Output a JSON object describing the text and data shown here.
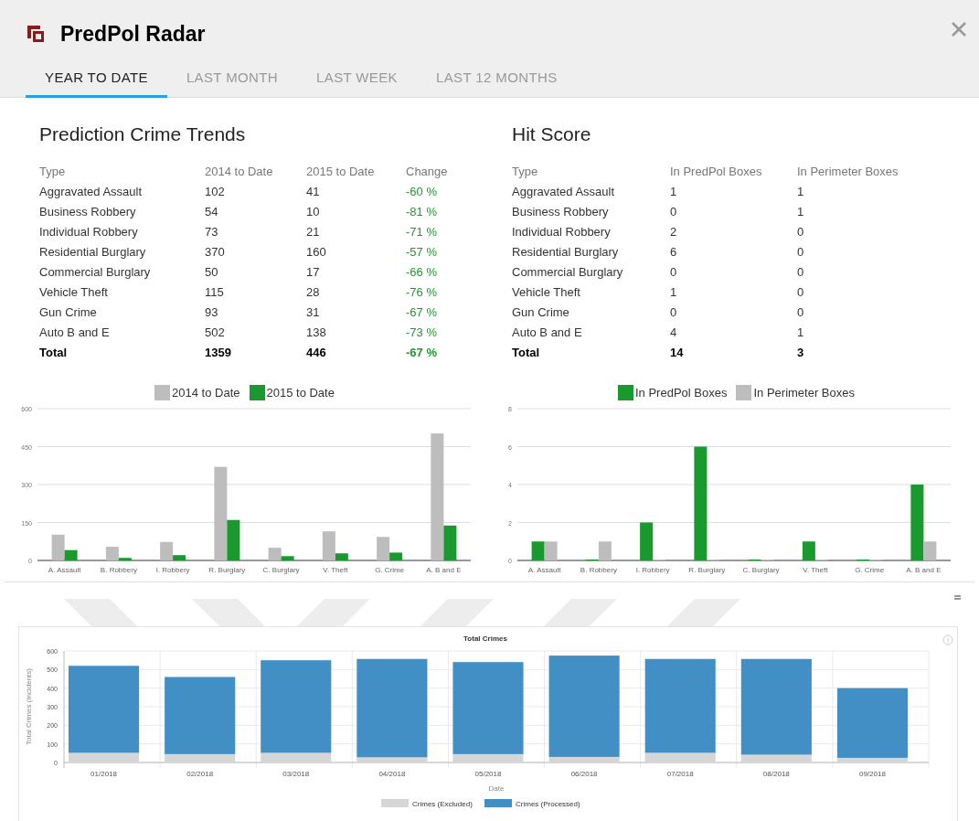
{
  "window": {
    "title": "PredPol Radar"
  },
  "tabs": [
    {
      "label": "YEAR TO DATE",
      "selected": true
    },
    {
      "label": "LAST MONTH",
      "selected": false
    },
    {
      "label": "LAST WEEK",
      "selected": false
    },
    {
      "label": "LAST 12 MONTHS",
      "selected": false
    }
  ],
  "prediction_trends": {
    "title": "Prediction Crime Trends",
    "columns": [
      "Type",
      "2014 to Date",
      "2015 to Date",
      "Change"
    ],
    "rows": [
      {
        "kind": "item",
        "cells": [
          "Aggravated Assault",
          "102",
          "41",
          "-60 %"
        ]
      },
      {
        "kind": "item",
        "cells": [
          "Business Robbery",
          "54",
          "10",
          "-81 %"
        ]
      },
      {
        "kind": "item",
        "cells": [
          "Individual Robbery",
          "73",
          "21",
          "-71 %"
        ]
      },
      {
        "kind": "item",
        "cells": [
          "Residential Burglary",
          "370",
          "160",
          "-57 %"
        ]
      },
      {
        "kind": "item",
        "cells": [
          "Commercial Burglary",
          "50",
          "17",
          "-66 %"
        ]
      },
      {
        "kind": "item",
        "cells": [
          "Vehicle Theft",
          "115",
          "28",
          "-76 %"
        ]
      },
      {
        "kind": "item",
        "cells": [
          "Gun Crime",
          "93",
          "31",
          "-67 %"
        ]
      },
      {
        "kind": "item",
        "cells": [
          "Auto B and E",
          "502",
          "138",
          "-73 %"
        ]
      },
      {
        "kind": "total",
        "cells": [
          "Total",
          "1359",
          "446",
          "-67 %"
        ]
      }
    ],
    "chart_data": {
      "type": "bar",
      "grid": true,
      "legend": "top",
      "categories": [
        "A. Assault",
        "B. Robbery",
        "I. Robbery",
        "R. Burglary",
        "C. Burglary",
        "V. Theft",
        "G. Crime",
        "A. B and E"
      ],
      "ylim": [
        0,
        600
      ],
      "yticks": [
        0,
        150,
        300,
        450,
        600
      ],
      "series": [
        {
          "name": "2014 to Date",
          "color": "#bdbdbd",
          "values": [
            102,
            54,
            73,
            370,
            50,
            115,
            93,
            502
          ]
        },
        {
          "name": "2015 to Date",
          "color": "#1a9a2e",
          "values": [
            41,
            10,
            21,
            160,
            17,
            28,
            31,
            138
          ]
        }
      ]
    }
  },
  "hit_score": {
    "title": "Hit Score",
    "columns": [
      "Type",
      "In PredPol Boxes",
      "In Perimeter Boxes"
    ],
    "rows": [
      {
        "kind": "item",
        "cells": [
          "Aggravated Assault",
          "1",
          "1"
        ]
      },
      {
        "kind": "item",
        "cells": [
          "Business Robbery",
          "0",
          "1"
        ]
      },
      {
        "kind": "item",
        "cells": [
          "Individual Robbery",
          "2",
          "0"
        ]
      },
      {
        "kind": "item",
        "cells": [
          "Residential Burglary",
          "6",
          "0"
        ]
      },
      {
        "kind": "item",
        "cells": [
          "Commercial Burglary",
          "0",
          "0"
        ]
      },
      {
        "kind": "item",
        "cells": [
          "Vehicle Theft",
          "1",
          "0"
        ]
      },
      {
        "kind": "item",
        "cells": [
          "Gun Crime",
          "0",
          "0"
        ]
      },
      {
        "kind": "item",
        "cells": [
          "Auto B and E",
          "4",
          "1"
        ]
      },
      {
        "kind": "total",
        "cells": [
          "Total",
          "14",
          "3"
        ]
      }
    ],
    "chart_data": {
      "type": "bar",
      "grid": true,
      "legend": "top",
      "categories": [
        "A. Assault",
        "B. Robbery",
        "I. Robbery",
        "R. Burglary",
        "C. Burglary",
        "V. Theft",
        "G. Crime",
        "A. B and E"
      ],
      "ylim": [
        0,
        8
      ],
      "yticks": [
        0,
        2,
        4,
        6,
        8
      ],
      "series": [
        {
          "name": "In PredPol Boxes",
          "color": "#1a9a2e",
          "values": [
            1,
            0,
            2,
            6,
            0,
            1,
            0,
            4
          ]
        },
        {
          "name": "In Perimeter Boxes",
          "color": "#bdbdbd",
          "values": [
            1,
            1,
            0,
            0,
            0,
            0,
            0,
            1
          ]
        }
      ]
    }
  },
  "total_crimes": {
    "chart_data": {
      "type": "bar",
      "stacked": true,
      "grid": true,
      "legend": "bottom",
      "title": "Total Crimes",
      "xlabel": "Date",
      "ylabel": "Total Crimes (Incidents)",
      "categories": [
        "01/2018",
        "02/2018",
        "03/2018",
        "04/2018",
        "05/2018",
        "06/2018",
        "07/2018",
        "08/2018",
        "09/2018"
      ],
      "ylim": [
        0,
        600
      ],
      "yticks": [
        0,
        100,
        200,
        300,
        400,
        500,
        600
      ],
      "series": [
        {
          "name": "Crimes (Excluded)",
          "color": "#d6d6d6",
          "values": [
            52,
            45,
            52,
            28,
            45,
            30,
            52,
            42,
            25
          ]
        },
        {
          "name": "Crimes (Processed)",
          "color": "#418fc5",
          "values": [
            468,
            415,
            498,
            529,
            495,
            545,
            505,
            515,
            375
          ]
        }
      ]
    }
  }
}
